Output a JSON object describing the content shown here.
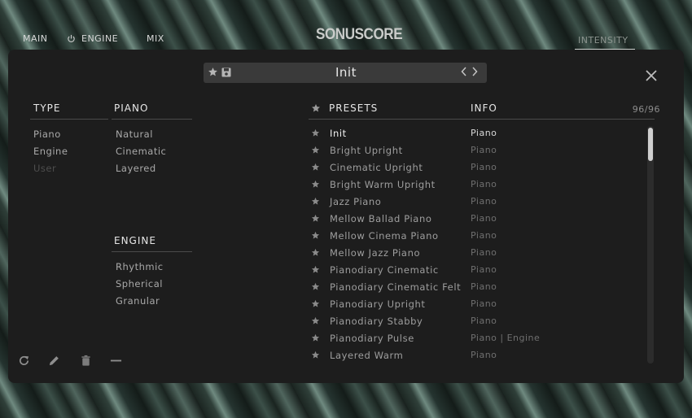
{
  "topbar": {
    "nav": {
      "main": "MAIN",
      "engine": "ENGINE",
      "mix": "MIX"
    },
    "logo": "SONUSCORE",
    "intensity_label": "INTENSITY"
  },
  "browser": {
    "preset_name": "Init",
    "count": "96/96",
    "type": {
      "header": "TYPE",
      "items": [
        "Piano",
        "Engine",
        "User"
      ]
    },
    "piano": {
      "header": "PIANO",
      "items": [
        "Natural",
        "Cinematic",
        "Layered"
      ]
    },
    "engine": {
      "header": "ENGINE",
      "items": [
        "Rhythmic",
        "Spherical",
        "Granular"
      ]
    },
    "columns": {
      "presets": "PRESETS",
      "info": "INFO"
    },
    "presets": [
      {
        "name": "Init",
        "info": "Piano",
        "selected": true
      },
      {
        "name": "Bright Upright",
        "info": "Piano"
      },
      {
        "name": "Cinematic Upright",
        "info": "Piano"
      },
      {
        "name": "Bright Warm Upright",
        "info": "Piano"
      },
      {
        "name": "Jazz Piano",
        "info": "Piano"
      },
      {
        "name": "Mellow Ballad Piano",
        "info": "Piano"
      },
      {
        "name": "Mellow Cinema Piano",
        "info": "Piano"
      },
      {
        "name": "Mellow Jazz Piano",
        "info": "Piano"
      },
      {
        "name": "Pianodiary Cinematic",
        "info": "Piano"
      },
      {
        "name": "Pianodiary Cinematic Felt",
        "info": "Piano"
      },
      {
        "name": "Pianodiary Upright",
        "info": "Piano"
      },
      {
        "name": "Pianodiary Stabby",
        "info": "Piano"
      },
      {
        "name": "Pianodiary Pulse",
        "info": "Piano | Engine"
      },
      {
        "name": "Layered Warm",
        "info": "Piano"
      }
    ]
  },
  "icons": {
    "power": "power-icon",
    "star": "star-icon",
    "save": "save-icon",
    "prev": "chevron-left-icon",
    "next": "chevron-right-icon",
    "close": "close-icon",
    "refresh": "refresh-icon",
    "edit": "pencil-icon",
    "delete": "trash-icon",
    "minus": "minus-icon"
  },
  "colors": {
    "panel": "#1d1d1d",
    "preset_bar": "#3a3a3a",
    "selected_text": "#f0f0f0"
  }
}
